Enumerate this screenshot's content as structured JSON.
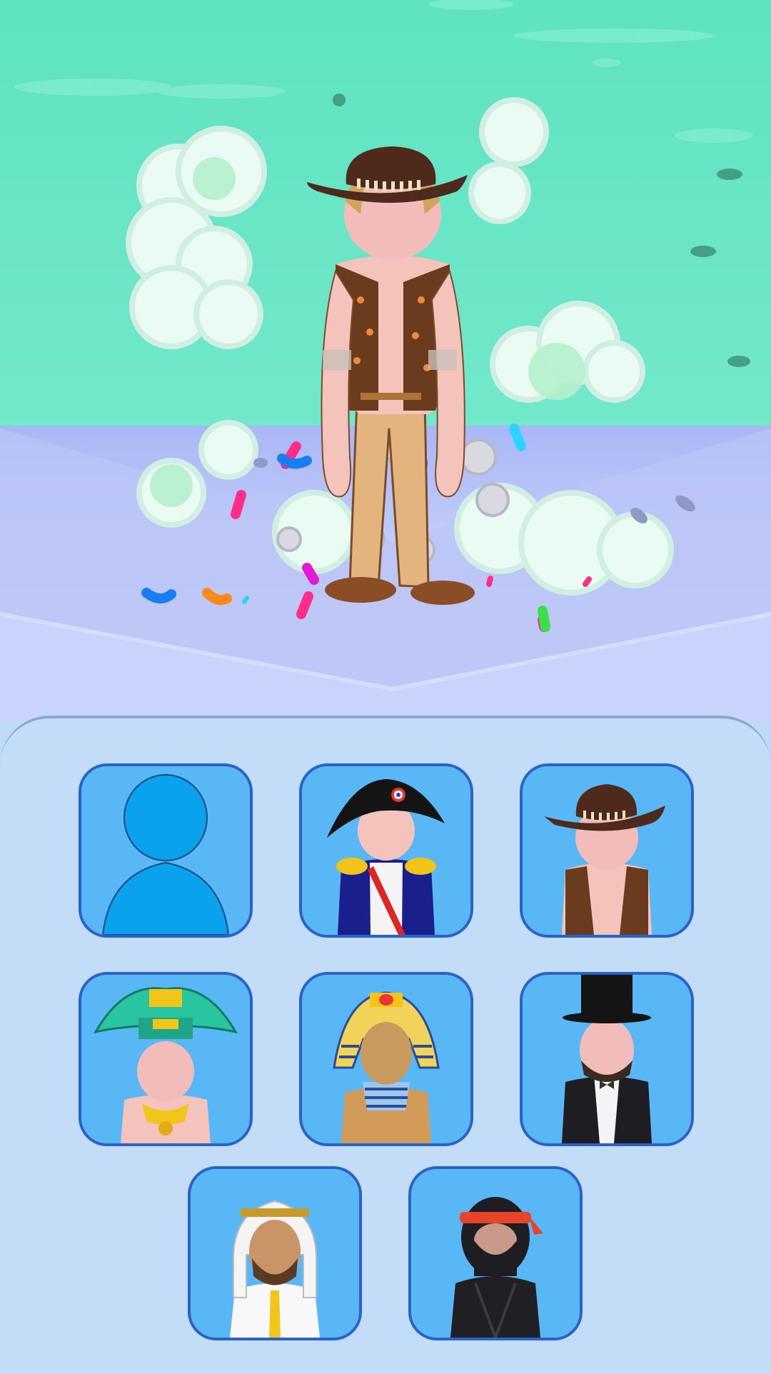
{
  "game": {
    "title": "",
    "selected_outfit": "cowboy"
  },
  "outfits": [
    {
      "id": "default-stickman",
      "icon": "blue-stickman-icon"
    },
    {
      "id": "napoleon",
      "icon": "bicorne-hat-icon"
    },
    {
      "id": "cowboy",
      "icon": "cowboy-hat-icon"
    },
    {
      "id": "aztec",
      "icon": "feather-headdress-icon"
    },
    {
      "id": "pharaoh",
      "icon": "pharaoh-headdress-icon"
    },
    {
      "id": "lincoln",
      "icon": "top-hat-icon"
    },
    {
      "id": "sheikh",
      "icon": "keffiyeh-icon"
    },
    {
      "id": "ninja",
      "icon": "ninja-mask-icon"
    }
  ],
  "colors": {
    "sky": "#67e5c4",
    "floor": "#c3cdf8",
    "panel": "#c3dcf8",
    "slot_fill": "#5ab7f5",
    "slot_border": "#2a63c7"
  }
}
